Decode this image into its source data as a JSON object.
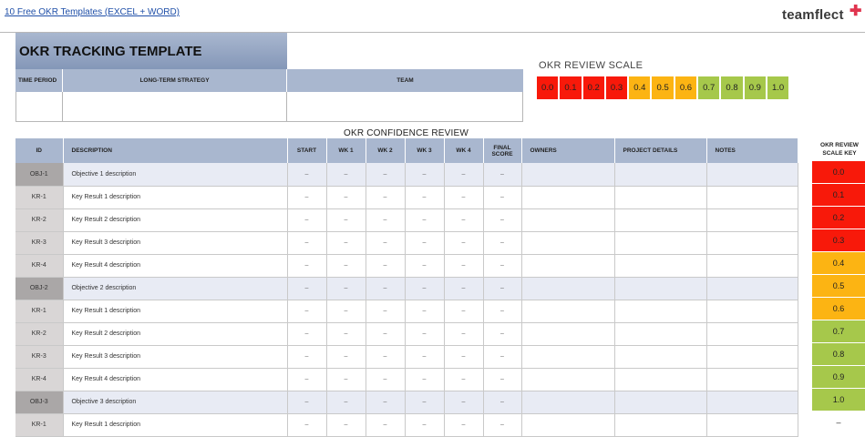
{
  "link": "10 Free OKR Templates (EXCEL + WORD)",
  "logo": "teamflect",
  "header": {
    "title": "OKR TRACKING TEMPLATE",
    "time_period": "TIME PERIOD",
    "strategy": "LONG-TERM STRATEGY",
    "team": "TEAM"
  },
  "scale": {
    "label": "OKR REVIEW SCALE",
    "values": [
      "0.0",
      "0.1",
      "0.2",
      "0.3",
      "0.4",
      "0.5",
      "0.6",
      "0.7",
      "0.8",
      "0.9",
      "1.0"
    ],
    "colors": {
      "red": "#f8190a",
      "orange": "#fcb413",
      "green": "#a6c84b"
    }
  },
  "confidence_title": "OKR CONFIDENCE REVIEW",
  "columns": {
    "id": "ID",
    "description": "DESCRIPTION",
    "start": "START",
    "wk1": "WK 1",
    "wk2": "WK 2",
    "wk3": "WK 3",
    "wk4": "WK 4",
    "final_1": "FINAL",
    "final_2": "SCORE",
    "owners": "OWNERS",
    "project_details": "PROJECT DETAILS",
    "notes": "NOTES"
  },
  "rows": [
    {
      "id": "OBJ-1",
      "desc": "Objective 1 description",
      "type": "obj"
    },
    {
      "id": "KR-1",
      "desc": "Key Result 1 description",
      "type": "kr"
    },
    {
      "id": "KR-2",
      "desc": "Key Result 2 description",
      "type": "kr"
    },
    {
      "id": "KR-3",
      "desc": "Key Result 3 description",
      "type": "kr"
    },
    {
      "id": "KR-4",
      "desc": "Key Result 4 description",
      "type": "kr"
    },
    {
      "id": "OBJ-2",
      "desc": "Objective 2 description",
      "type": "obj"
    },
    {
      "id": "KR-1",
      "desc": "Key Result 1 description",
      "type": "kr"
    },
    {
      "id": "KR-2",
      "desc": "Key Result 2 description",
      "type": "kr"
    },
    {
      "id": "KR-3",
      "desc": "Key Result 3 description",
      "type": "kr"
    },
    {
      "id": "KR-4",
      "desc": "Key Result 4 description",
      "type": "kr"
    },
    {
      "id": "OBJ-3",
      "desc": "Objective 3 description",
      "type": "obj"
    },
    {
      "id": "KR-1",
      "desc": "Key Result 1 description",
      "type": "kr"
    }
  ],
  "dash": "–",
  "key": {
    "title_1": "OKR REVIEW",
    "title_2": "SCALE KEY",
    "values": [
      "0.0",
      "0.1",
      "0.2",
      "0.3",
      "0.4",
      "0.5",
      "0.6",
      "0.7",
      "0.8",
      "0.9",
      "1.0",
      "–"
    ]
  }
}
